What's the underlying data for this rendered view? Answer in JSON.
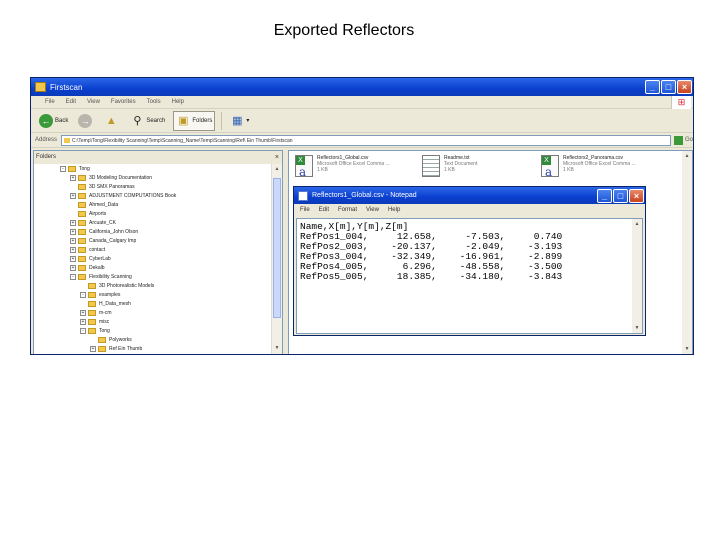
{
  "slide": {
    "title": "Exported Reflectors"
  },
  "explorer": {
    "title": "Firstscan",
    "menu": [
      "File",
      "Edit",
      "View",
      "Favorites",
      "Tools",
      "Help"
    ],
    "toolbar": {
      "back": "Back",
      "search": "Search",
      "folders": "Folders"
    },
    "address": {
      "label": "Address",
      "value": "C:\\Temp\\Tong\\Flexibility Scanning\\Temp\\Scanning_Name\\Temp\\Scanning\\Ref\\ Ein Thumb\\Firstscan",
      "go": "Go"
    },
    "folders": {
      "header": "Folders",
      "items": [
        {
          "label": "Tong",
          "expander": "-",
          "indent": 0
        },
        {
          "label": "3D Modeling Documentation",
          "expander": "+",
          "indent": 1
        },
        {
          "label": "3D SMX Panoramas",
          "expander": "",
          "indent": 1
        },
        {
          "label": "ADJUSTMENT COMPUTATIONS Book",
          "expander": "+",
          "indent": 1
        },
        {
          "label": "Ahmed_Data",
          "expander": "",
          "indent": 1
        },
        {
          "label": "Airports",
          "expander": "",
          "indent": 1
        },
        {
          "label": "Arcuate_CK",
          "expander": "+",
          "indent": 1
        },
        {
          "label": "California_John Olson",
          "expander": "+",
          "indent": 1
        },
        {
          "label": "Canada_Calgary Imp",
          "expander": "+",
          "indent": 1
        },
        {
          "label": "contact",
          "expander": "+",
          "indent": 1
        },
        {
          "label": "CyberLab",
          "expander": "+",
          "indent": 1
        },
        {
          "label": "Dekalb",
          "expander": "+",
          "indent": 1
        },
        {
          "label": "Flexibility Scanning",
          "expander": "-",
          "indent": 1
        },
        {
          "label": "3D Photorealistic Models",
          "expander": "",
          "indent": 2
        },
        {
          "label": "examples",
          "expander": "-",
          "indent": 2
        },
        {
          "label": "H_Data_mesh",
          "expander": "",
          "indent": 2
        },
        {
          "label": "m-cm",
          "expander": "+",
          "indent": 2
        },
        {
          "label": "misc",
          "expander": "+",
          "indent": 2
        },
        {
          "label": "Tong",
          "expander": "-",
          "indent": 2
        },
        {
          "label": "Polyworks",
          "expander": "",
          "indent": 3
        },
        {
          "label": "Ref Ein Thumb",
          "expander": "+",
          "indent": 3
        }
      ]
    },
    "files": [
      {
        "name": "Reflectors1_Global.csv",
        "type": "Microsoft Office Excel Comma ...",
        "size": "1 KB",
        "icon": "xls"
      },
      {
        "name": "Readme.txt",
        "type": "Text Document",
        "size": "1 KB",
        "icon": "txt"
      },
      {
        "name": "Reflectors2_Panorama.csv",
        "type": "Microsoft Office Excel Comma ...",
        "size": "1 KB",
        "icon": "xls"
      }
    ]
  },
  "notepad": {
    "title": "Reflectors1_Global.csv - Notepad",
    "menu": [
      "File",
      "Edit",
      "Format",
      "View",
      "Help"
    ],
    "header": "Name,X[m],Y[m],Z[m]",
    "rows": [
      {
        "name": "RefPos1_004",
        "x": "12.658",
        "y": "-7.503",
        "z": "0.740"
      },
      {
        "name": "RefPos2_003",
        "x": "-20.137",
        "y": "-2.049",
        "z": "-3.193"
      },
      {
        "name": "RefPos3_004",
        "x": "-32.349",
        "y": "-16.961",
        "z": "-2.899"
      },
      {
        "name": "RefPos4_005",
        "x": "6.296",
        "y": "-48.558",
        "z": "-3.500"
      },
      {
        "name": "RefPos5_005",
        "x": "18.385",
        "y": "-34.180",
        "z": "-3.843"
      }
    ]
  }
}
